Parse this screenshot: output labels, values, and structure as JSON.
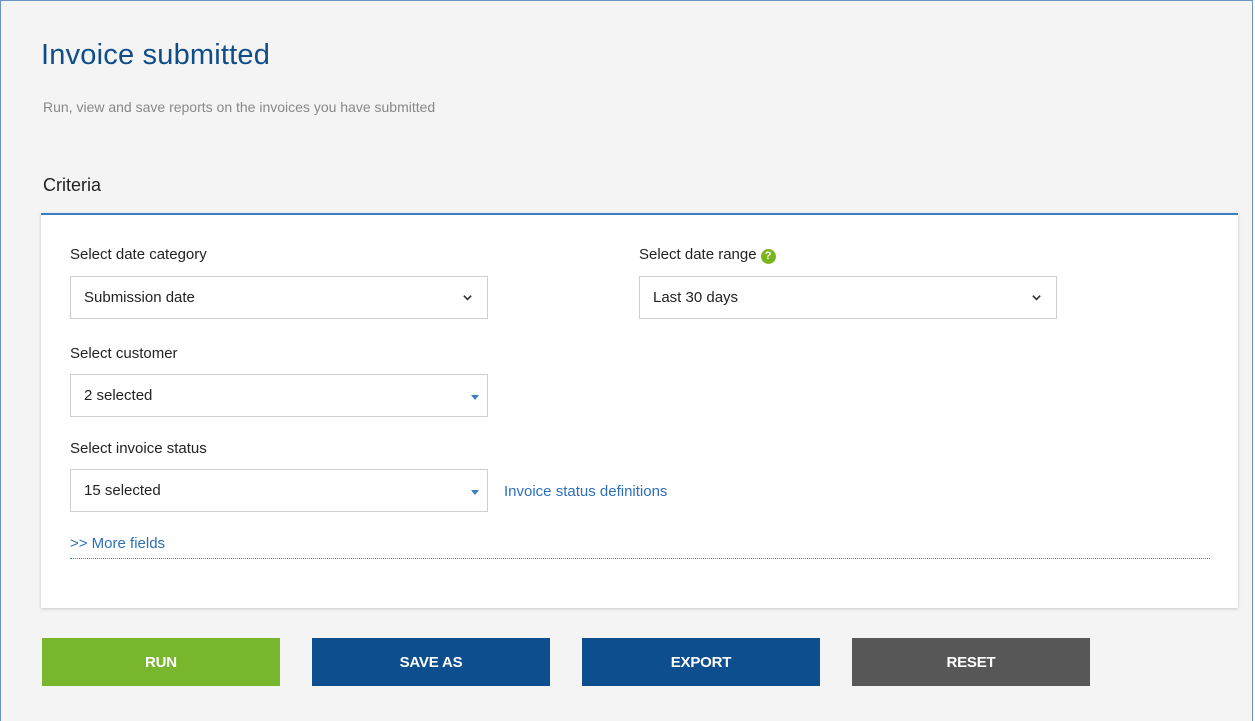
{
  "header": {
    "title": "Invoice submitted",
    "subtitle": "Run, view and save reports on the invoices you have submitted"
  },
  "criteria": {
    "title": "Criteria",
    "date_category": {
      "label": "Select date category",
      "value": "Submission date"
    },
    "date_range": {
      "label": "Select date range",
      "help_icon": "question-circle-icon",
      "help_glyph": "?",
      "value": "Last 30 days"
    },
    "customer": {
      "label": "Select customer",
      "value": "2 selected"
    },
    "invoice_status": {
      "label": "Select invoice status",
      "value": "15 selected",
      "definitions_link": "Invoice status definitions"
    },
    "more_fields_link": ">> More fields"
  },
  "actions": {
    "run": "RUN",
    "save_as": "SAVE AS",
    "export": "EXPORT",
    "reset": "RESET"
  },
  "colors": {
    "title": "#0f4c8a",
    "accent": "#3d7dc4",
    "run": "#78b62d",
    "primary": "#0d4f8e",
    "reset": "#575757",
    "help": "#7ab51d"
  }
}
